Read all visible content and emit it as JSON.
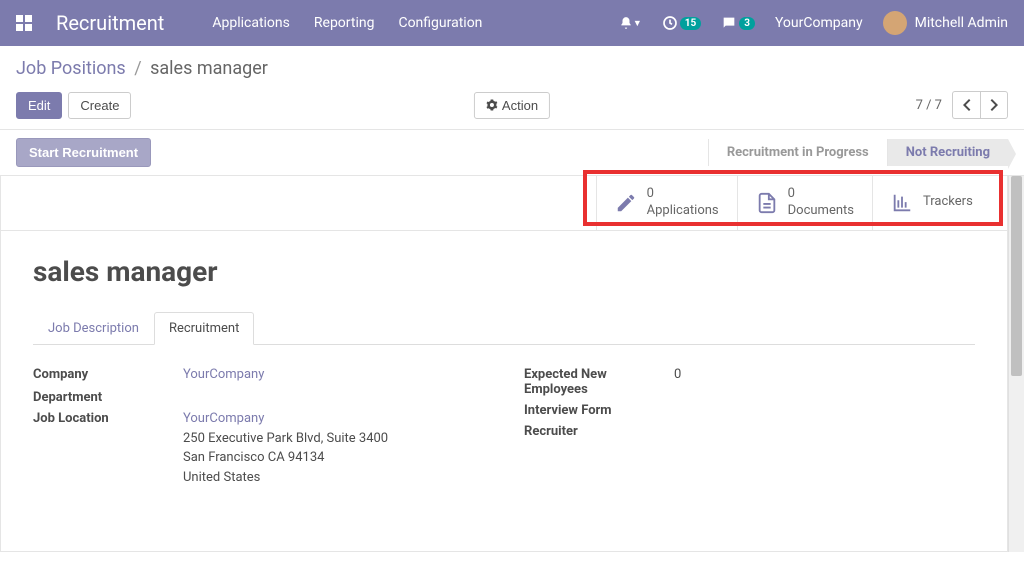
{
  "navbar": {
    "brand": "Recruitment",
    "items": [
      "Applications",
      "Reporting",
      "Configuration"
    ],
    "clock_badge": "15",
    "chat_badge": "3",
    "company": "YourCompany",
    "user": "Mitchell Admin"
  },
  "breadcrumb": {
    "parent": "Job Positions",
    "current": "sales manager"
  },
  "buttons": {
    "edit": "Edit",
    "create": "Create",
    "action": "Action",
    "start_recruitment": "Start Recruitment"
  },
  "pager": {
    "count": "7 / 7"
  },
  "stages": {
    "in_progress": "Recruitment in Progress",
    "not_recruiting": "Not Recruiting"
  },
  "stat_buttons": {
    "applications_count": "0",
    "applications_label": "Applications",
    "documents_count": "0",
    "documents_label": "Documents",
    "trackers_label": "Trackers"
  },
  "record": {
    "title": "sales manager"
  },
  "tabs": {
    "job_desc": "Job Description",
    "recruitment": "Recruitment"
  },
  "form": {
    "left": {
      "company_label": "Company",
      "company_value": "YourCompany",
      "department_label": "Department",
      "location_label": "Job Location",
      "location_company": "YourCompany",
      "location_line1": "250 Executive Park Blvd, Suite 3400",
      "location_line2": "San Francisco CA 94134",
      "location_line3": "United States"
    },
    "right": {
      "expected_label_1": "Expected New",
      "expected_label_2": "Employees",
      "expected_value": "0",
      "interview_label": "Interview Form",
      "recruiter_label": "Recruiter"
    }
  }
}
